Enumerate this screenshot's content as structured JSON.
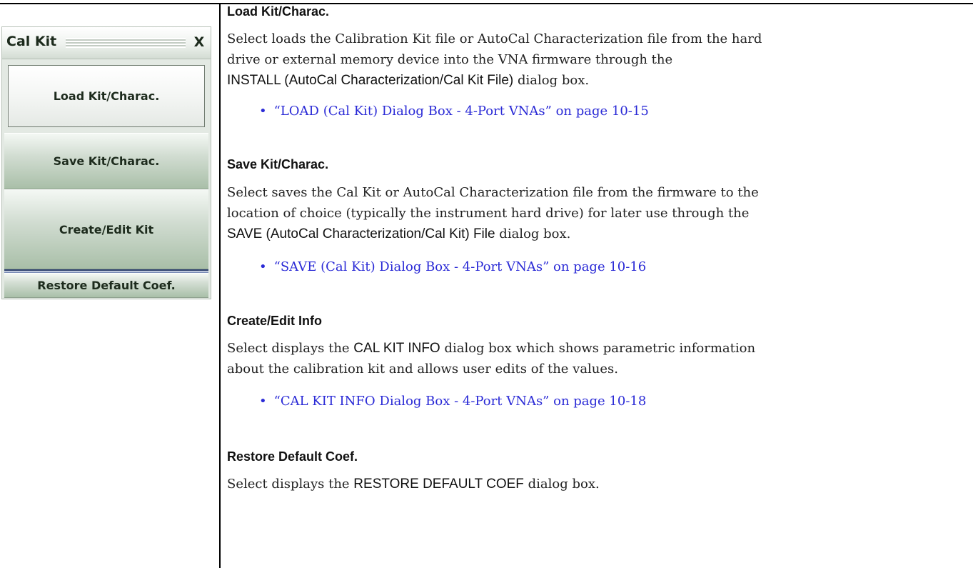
{
  "menu": {
    "title": "Cal Kit",
    "close_label": "X",
    "buttons": [
      {
        "label": "Load Kit/Charac."
      },
      {
        "label": "Save Kit/Charac."
      },
      {
        "label": "Create/Edit Kit"
      },
      {
        "label": "Restore Default Coef."
      }
    ]
  },
  "sections": {
    "load": {
      "heading": "Load Kit/Charac.",
      "line1": "Select loads the Calibration Kit file or AutoCal Characterization file from the hard",
      "line2": "drive or external memory device into the VNA firmware through the",
      "dialog_name": "INSTALL (AutoCal Characterization/Cal Kit File)",
      "line3_tail": " dialog box.",
      "link": "“LOAD (Cal Kit) Dialog Box - 4-Port VNAs” on page 10-15"
    },
    "save": {
      "heading": "Save Kit/Charac.",
      "line1": "Select saves the Cal Kit or AutoCal Characterization file from the firmware to the",
      "line2": "location of choice (typically the instrument hard drive) for later use through the",
      "dialog_name": "SAVE (AutoCal Characterization/Cal Kit) File",
      "line3_tail": " dialog box.",
      "link": "“SAVE (Cal Kit) Dialog Box - 4-Port VNAs” on page 10-16"
    },
    "create": {
      "heading": "Create/Edit Info",
      "line1_head": "Select displays the ",
      "dialog_name": "CAL KIT INFO",
      "line1_tail": " dialog box which shows parametric information",
      "line2": "about the calibration kit and allows user edits of the values.",
      "link": "“CAL KIT INFO Dialog Box - 4-Port VNAs” on page 10-18"
    },
    "restore": {
      "heading": "Restore Default Coef.",
      "line1_head": "Select displays the ",
      "dialog_name": "RESTORE DEFAULT COEF",
      "line1_tail": " dialog box."
    }
  }
}
